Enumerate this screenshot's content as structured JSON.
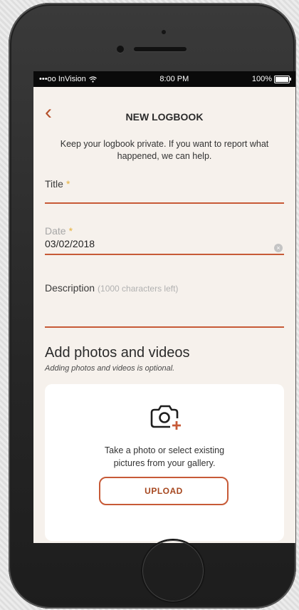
{
  "status_bar": {
    "carrier": "•••oo InVision",
    "time": "8:00 PM",
    "battery": "100%"
  },
  "nav": {
    "back_glyph": "‹",
    "title": "NEW LOGBOOK"
  },
  "intro_text": "Keep your logbook private. If you want to report what happened, we can help.",
  "form": {
    "title": {
      "label": "Title",
      "required_mark": "*"
    },
    "date": {
      "label": "Date",
      "required_mark": "*",
      "value": "03/02/2018",
      "clear_glyph": "×"
    },
    "description": {
      "label": "Description",
      "hint": "(1000 characters left)"
    }
  },
  "media": {
    "heading": "Add photos and videos",
    "subheading": "Adding photos and videos is optional.",
    "card_text": "Take a photo or select existing pictures from your gallery.",
    "upload_label": "UPLOAD",
    "icon": "camera-plus-icon"
  },
  "colors": {
    "accent": "#c75a37",
    "required": "#e7b13b",
    "screen_bg": "#f6f1ec"
  }
}
